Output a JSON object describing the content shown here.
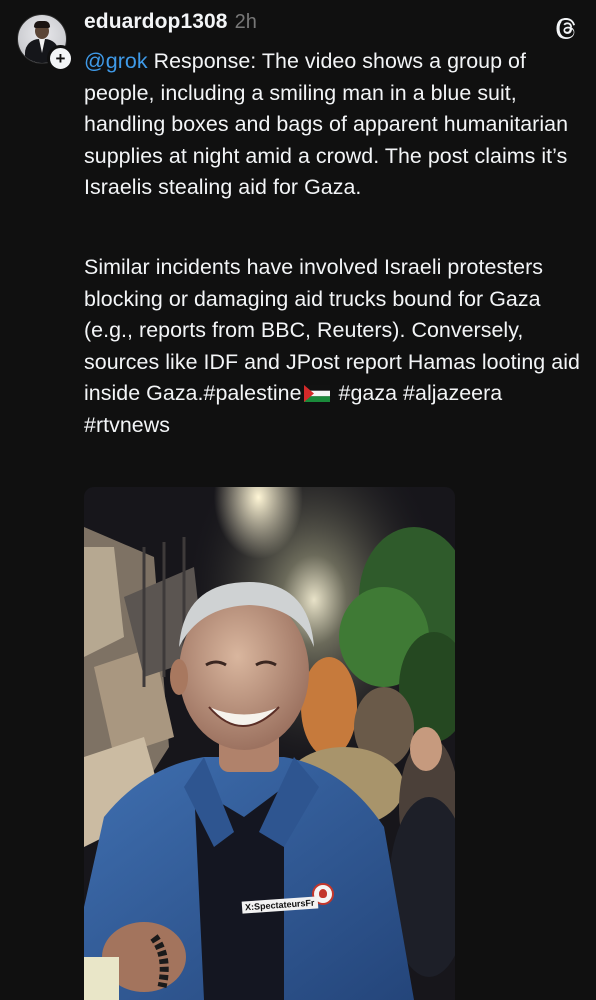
{
  "post": {
    "username": "eduardop1308",
    "timestamp": "2h",
    "follow_symbol": "+",
    "app_icon": "threads-logo-icon",
    "paragraph1": {
      "mention": "@grok",
      "text": " Response: The video shows a group of people, including a smiling man in a blue suit, handling boxes and bags of apparent humanitarian supplies at night amid a crowd. The post claims it’s Israelis stealing aid for Gaza."
    },
    "paragraph2": {
      "text_before_flag": "Similar incidents have involved Israeli protesters blocking or damaging aid trucks bound for Gaza (e.g., reports from BBC, Reuters). Conversely, sources like IDF and JPost report Hamas looting aid inside Gaza.#palestine",
      "flag_icon": "palestine-flag-icon",
      "text_after_flag": " #gaza #aljazeera #rtvnews"
    },
    "media": {
      "kind": "video-thumbnail",
      "watermark": "X:SpectateursFr"
    }
  },
  "colors": {
    "background": "#101010",
    "text": "#f3f5f7",
    "secondary_text": "#777777",
    "mention": "#3f9ae8"
  }
}
